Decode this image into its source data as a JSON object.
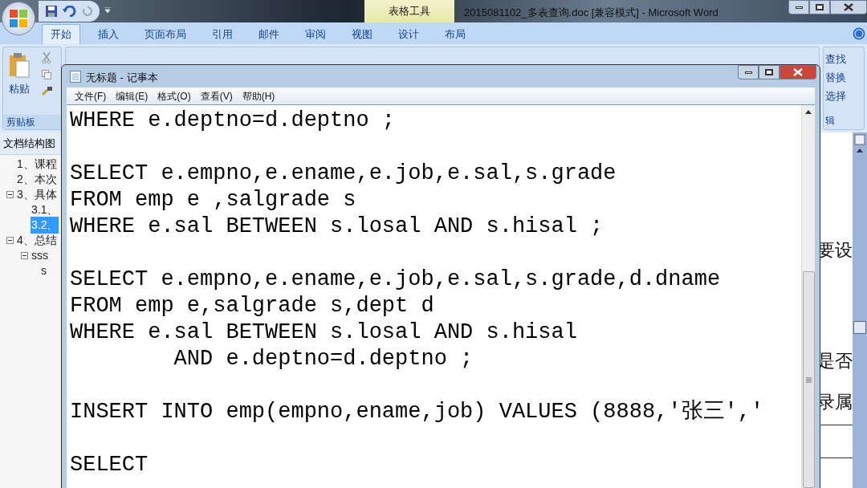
{
  "word_window": {
    "title": "2015081102_多表查询.doc [兼容模式] - Microsoft Word",
    "contextual_tab_group": "表格工具",
    "tabs": [
      {
        "label": "开始",
        "selected": true
      },
      {
        "label": "插入",
        "selected": false
      },
      {
        "label": "页面布局",
        "selected": false
      },
      {
        "label": "引用",
        "selected": false
      },
      {
        "label": "邮件",
        "selected": false
      },
      {
        "label": "审阅",
        "selected": false
      },
      {
        "label": "视图",
        "selected": false
      },
      {
        "label": "设计",
        "selected": false
      },
      {
        "label": "布局",
        "selected": false
      }
    ],
    "ribbon": {
      "clipboard_group": {
        "label": "剪贴板",
        "paste_button": "粘贴"
      },
      "editing_group": {
        "label": "辑",
        "buttons": [
          "查找",
          "替换",
          "选择"
        ]
      }
    },
    "navigation_pane": {
      "title": "文档结构图",
      "items": [
        {
          "label": "1、课程",
          "selected": false
        },
        {
          "label": "2、本次",
          "selected": false
        },
        {
          "label": "3、具体",
          "selected": false,
          "expanded": true,
          "children": [
            {
              "label": "3.1、",
              "selected": false
            },
            {
              "label": "3.2、",
              "selected": true
            }
          ]
        },
        {
          "label": "4、总结",
          "selected": false,
          "expanded": true,
          "children": [
            {
              "label": "sss",
              "selected": false,
              "expanded": true,
              "children": [
                {
                  "label": "s",
                  "selected": false
                }
              ]
            }
          ]
        }
      ]
    },
    "document_text": [
      "要设",
      "是否",
      "录属"
    ]
  },
  "notepad": {
    "title": "无标题 - 记事本",
    "menu": [
      "文件(F)",
      "编辑(E)",
      "格式(O)",
      "查看(V)",
      "帮助(H)"
    ],
    "blocks": [
      [
        "WHERE e.deptno=d.deptno ;"
      ],
      [
        "SELECT e.empno,e.ename,e.job,e.sal,s.grade",
        "FROM emp e ,salgrade s",
        "WHERE e.sal BETWEEN s.losal AND s.hisal ;"
      ],
      [
        "SELECT e.empno,e.ename,e.job,e.sal,s.grade,d.dname",
        "FROM emp e,salgrade s,dept d",
        "WHERE e.sal BETWEEN s.losal AND s.hisal",
        "        AND e.deptno=d.deptno ;"
      ],
      [
        "INSERT INTO emp(empno,ename,job) VALUES (8888,'张三','"
      ],
      [
        "SELECT"
      ]
    ]
  }
}
